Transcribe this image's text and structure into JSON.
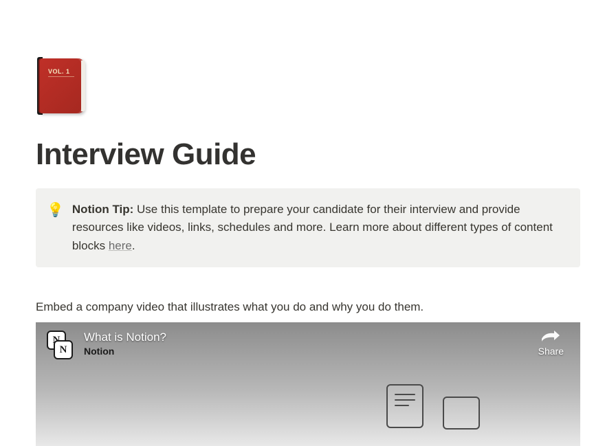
{
  "page": {
    "icon_label": "VOL. 1",
    "title": "Interview Guide"
  },
  "callout": {
    "icon": "💡",
    "label": "Notion Tip:",
    "body_before_link": " Use this template to prepare your candidate for their interview and provide resources like videos, links, schedules and more. Learn more about different types of content blocks ",
    "link_text": "here",
    "body_after_link": "."
  },
  "section": {
    "intro_text": "Embed a company video that illustrates what you do and why you do them."
  },
  "video": {
    "logo_letter": "N",
    "title": "What is Notion?",
    "channel": "Notion",
    "share_label": "Share"
  }
}
